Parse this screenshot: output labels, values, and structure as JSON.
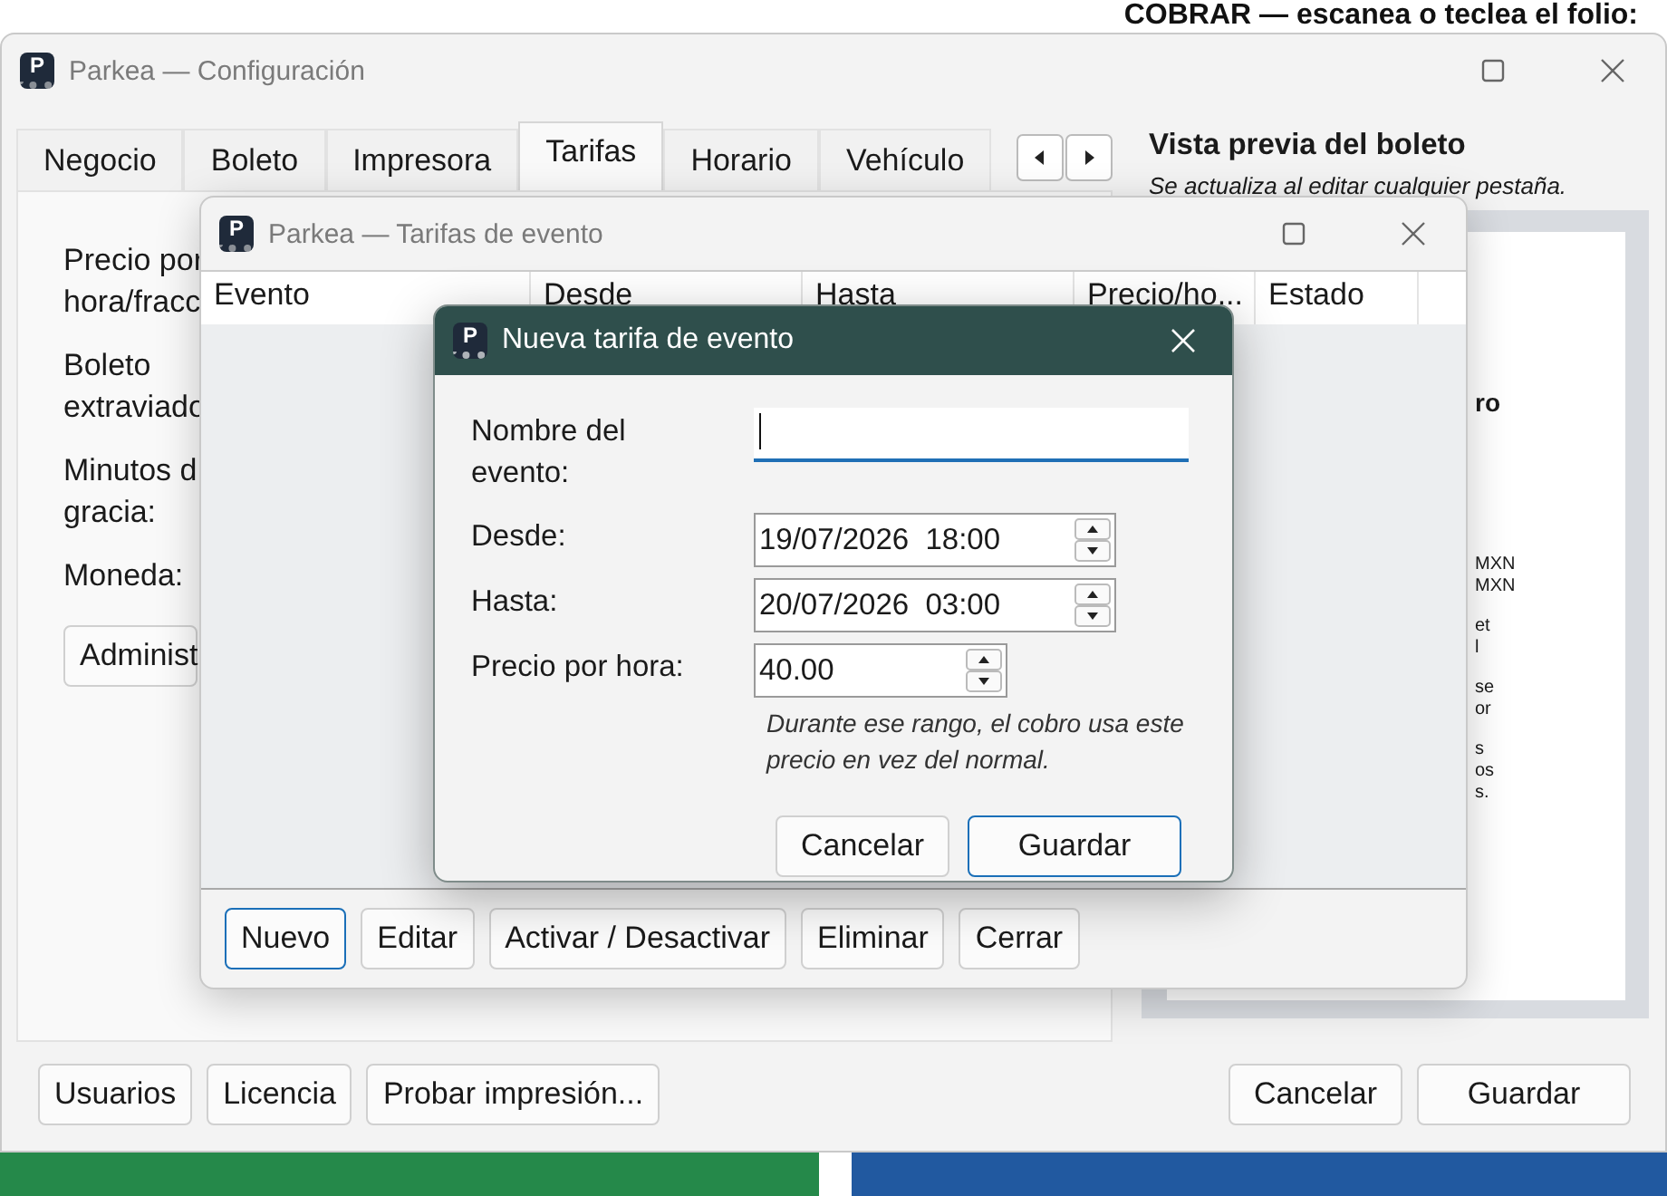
{
  "banner": {
    "text": "COBRAR — escanea o teclea el folio:"
  },
  "main_window": {
    "icon_letter": "P",
    "title": "Parkea — Configuración",
    "tabs": [
      {
        "label": "Negocio",
        "selected": false
      },
      {
        "label": "Boleto",
        "selected": false
      },
      {
        "label": "Impresora",
        "selected": false
      },
      {
        "label": "Tarifas",
        "selected": true
      },
      {
        "label": "Horario",
        "selected": false
      },
      {
        "label": "Vehículo",
        "selected": false
      }
    ],
    "form_labels": [
      "Precio por hora/fracc",
      "Boleto extraviado",
      "Minutos d gracia:",
      "Moneda:"
    ],
    "admin_button": "Administ",
    "preview": {
      "title": "Vista previa del boleto",
      "subtitle": "Se actualiza al editar cualquier pestaña.",
      "fragments": [
        {
          "kind": "heading",
          "lines": [
            "ro"
          ]
        },
        {
          "kind": "text",
          "lines": [
            "MXN",
            "MXN"
          ]
        },
        {
          "kind": "text",
          "lines": [
            "et",
            "l"
          ]
        },
        {
          "kind": "text",
          "lines": [
            "se",
            "or"
          ]
        },
        {
          "kind": "text",
          "lines": [
            "s",
            "os",
            "s."
          ]
        }
      ]
    },
    "footer_left": [
      {
        "label": "Usuarios",
        "focused": false
      },
      {
        "label": "Licencia",
        "focused": false
      },
      {
        "label": "Probar impresión...",
        "focused": false
      }
    ],
    "footer_right": [
      {
        "label": "Cancelar",
        "focused": false
      },
      {
        "label": "Guardar",
        "focused": false
      }
    ]
  },
  "event_window": {
    "icon_letter": "P",
    "title": "Parkea — Tarifas de evento",
    "columns": [
      "Evento",
      "Desde",
      "Hasta",
      "Precio/ho...",
      "Estado"
    ],
    "buttons": [
      {
        "label": "Nuevo",
        "focused": true
      },
      {
        "label": "Editar",
        "focused": false
      },
      {
        "label": "Activar / Desactivar",
        "focused": false
      },
      {
        "label": "Eliminar",
        "focused": false
      },
      {
        "label": "Cerrar",
        "focused": false
      }
    ]
  },
  "dialog": {
    "icon_letter": "P",
    "title": "Nueva tarifa de evento",
    "fields": [
      {
        "kind": "text",
        "label": "Nombre del evento:",
        "focused": true
      },
      {
        "kind": "spin",
        "label": "Desde:",
        "value": "19/07/2026  18:00",
        "focused": false
      },
      {
        "kind": "spin",
        "label": "Hasta:",
        "value": "20/07/2026  03:00",
        "focused": false
      },
      {
        "kind": "spin_short",
        "label": "Precio por hora:",
        "value": "40.00",
        "focused": false
      }
    ],
    "hint": "Durante ese rango, el cobro usa este precio en vez del normal.",
    "buttons": [
      {
        "label": "Cancelar",
        "focused": false
      },
      {
        "label": "Guardar",
        "focused": true
      }
    ]
  }
}
